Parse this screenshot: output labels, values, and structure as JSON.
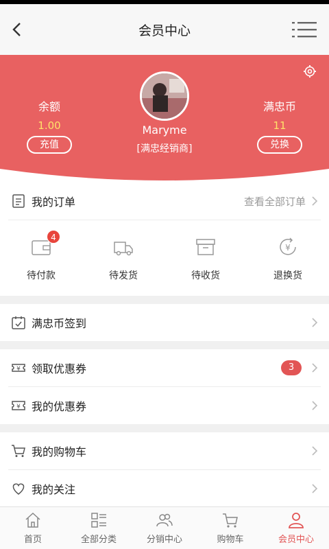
{
  "header": {
    "title": "会员中心"
  },
  "profile": {
    "balance_label": "余额",
    "balance_value": "1.00",
    "recharge_button": "充值",
    "coins_label": "满忠币",
    "coins_value": "11",
    "exchange_button": "兑换",
    "username": "Maryme",
    "level": "[满忠经销商]"
  },
  "orders": {
    "title": "我的订单",
    "view_all": "查看全部订单",
    "items": [
      {
        "label": "待付款",
        "badge": "4"
      },
      {
        "label": "待发货"
      },
      {
        "label": "待收货"
      },
      {
        "label": "退换货"
      }
    ]
  },
  "menu": {
    "checkin": "满忠币签到",
    "get_coupons": "领取优惠券",
    "get_coupons_count": "3",
    "my_coupons": "我的优惠券",
    "cart": "我的购物车",
    "follow": "我的关注"
  },
  "tabbar": [
    {
      "label": "首页"
    },
    {
      "label": "全部分类"
    },
    {
      "label": "分销中心"
    },
    {
      "label": "购物车"
    },
    {
      "label": "会员中心",
      "active": true
    }
  ],
  "colors": {
    "accent": "#e25555",
    "coin_yellow": "#ffe26a",
    "badge_red": "#e8453c"
  }
}
